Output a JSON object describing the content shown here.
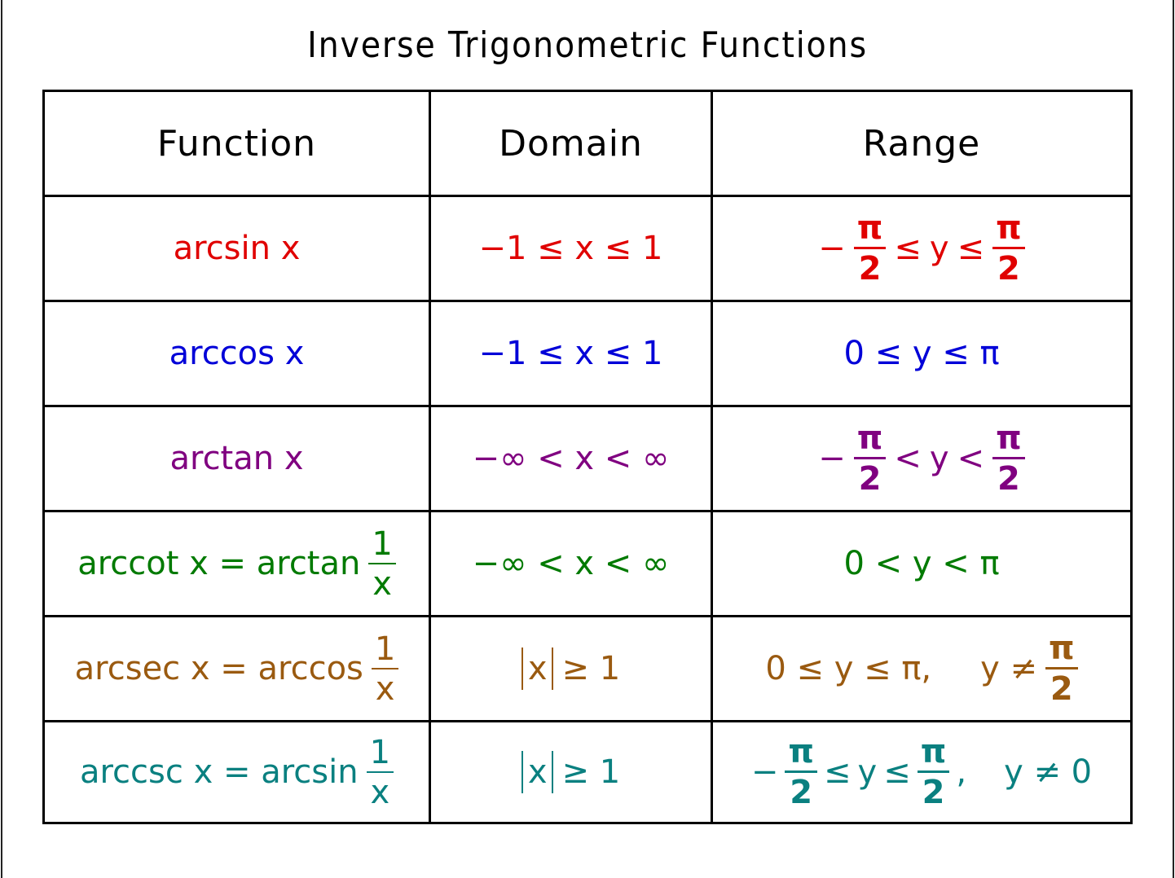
{
  "title": "Inverse Trigonometric Functions",
  "headers": {
    "function": "Function",
    "domain": "Domain",
    "range": "Range"
  },
  "colors": {
    "arcsin": "#e00000",
    "arccos": "#0000d8",
    "arctan": "#800080",
    "arccot": "#007a00",
    "arcsec": "#9a5a10",
    "arccsc": "#0a8080"
  },
  "rows": [
    {
      "function": "arcsin x",
      "domain": "−1 ≤ x ≤ 1",
      "range": {
        "neg": "−",
        "frac_num": "π",
        "frac_den": "2",
        "op1": "≤",
        "var": "y",
        "op2": "≤",
        "frac2_num": "π",
        "frac2_den": "2"
      }
    },
    {
      "function": "arccos x",
      "domain": "−1 ≤ x ≤ 1",
      "range": "0 ≤ y ≤ π"
    },
    {
      "function": "arctan x",
      "domain": "−∞ < x < ∞",
      "range": {
        "neg": "−",
        "frac_num": "π",
        "frac_den": "2",
        "op1": "<",
        "var": "y",
        "op2": "<",
        "frac2_num": "π",
        "frac2_den": "2"
      }
    },
    {
      "function": {
        "lhs": "arccot x = arctan",
        "frac_num": "1",
        "frac_den": "x"
      },
      "domain": "−∞ < x < ∞",
      "range": "0 < y < π"
    },
    {
      "function": {
        "lhs": "arcsec x = arccos",
        "frac_num": "1",
        "frac_den": "x"
      },
      "domain": {
        "abs": "x",
        "rest": "≥ 1"
      },
      "range": {
        "part1": "0 ≤ y ≤ π,",
        "part2": "y ≠",
        "frac_num": "π",
        "frac_den": "2"
      }
    },
    {
      "function": {
        "lhs": "arccsc x = arcsin",
        "frac_num": "1",
        "frac_den": "x"
      },
      "domain": {
        "abs": "x",
        "rest": "≥ 1"
      },
      "range": {
        "neg": "−",
        "frac_num": "π",
        "frac_den": "2",
        "op1": "≤",
        "var": "y",
        "op2": "≤",
        "frac2_num": "π",
        "frac2_den": "2",
        "comma": ",",
        "part2": "y ≠ 0"
      }
    }
  ]
}
